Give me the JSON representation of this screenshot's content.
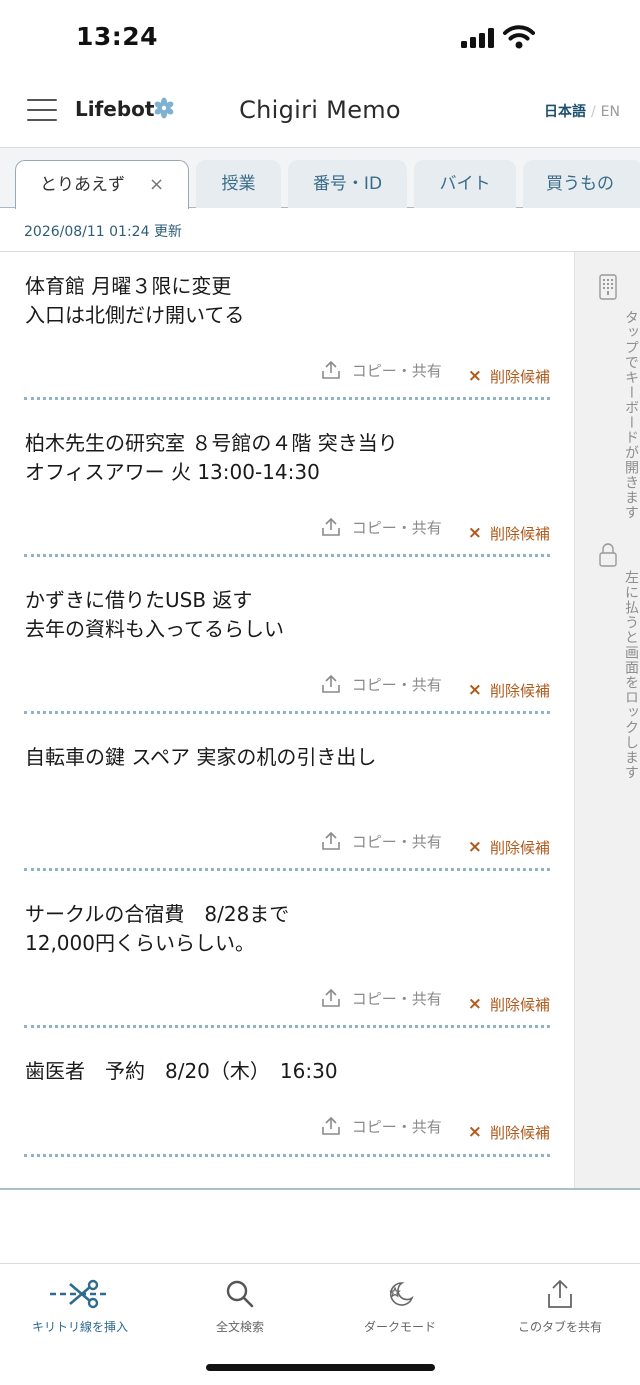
{
  "status_bar": {
    "time": "13:24"
  },
  "header": {
    "brand": "Lifebot",
    "title": "Chigiri Memo",
    "lang_ja": "日本語",
    "lang_sep": "/",
    "lang_en": "EN"
  },
  "tabs": [
    {
      "label": "とりあえず",
      "active": true,
      "close": "×"
    },
    {
      "label": "授業"
    },
    {
      "label": "番号・ID"
    },
    {
      "label": "バイト"
    },
    {
      "label": "買うもの"
    }
  ],
  "updated_at": "2026/08/11 01:24 更新",
  "actions": {
    "share": "コピー・共有",
    "delete_mark": "×",
    "delete": "削除候補"
  },
  "memos": [
    {
      "text": "体育館 月曜３限に変更\n入口は北側だけ開いてる"
    },
    {
      "text": "柏木先生の研究室 ８号館の４階 突き当り\nオフィスアワー 火 13:00-14:30"
    },
    {
      "text": "かずきに借りたUSB 返す\n去年の資料も入ってるらしい"
    },
    {
      "text": "自転車の鍵 スペア 実家の机の引き出し"
    },
    {
      "text": "サークルの合宿費　8/28まで\n12,000円くらいらしい。"
    },
    {
      "text": "歯医者　予約　8/20（木）　16:30"
    }
  ],
  "side_panel": {
    "keyboard_hint": "タップでキーボードが開きます",
    "lock_hint": "左に払うと画面をロックします"
  },
  "bottom_nav": [
    {
      "label": "キリトリ線を挿入",
      "icon": "scissors-icon",
      "active": true
    },
    {
      "label": "全文検索",
      "icon": "search-icon"
    },
    {
      "label": "ダークモード",
      "icon": "moon-star-icon"
    },
    {
      "label": "このタブを共有",
      "icon": "share-icon"
    }
  ],
  "colors": {
    "accent": "#2f6b8f",
    "delete": "#b05a1c",
    "separator": "#8fb3c9"
  }
}
